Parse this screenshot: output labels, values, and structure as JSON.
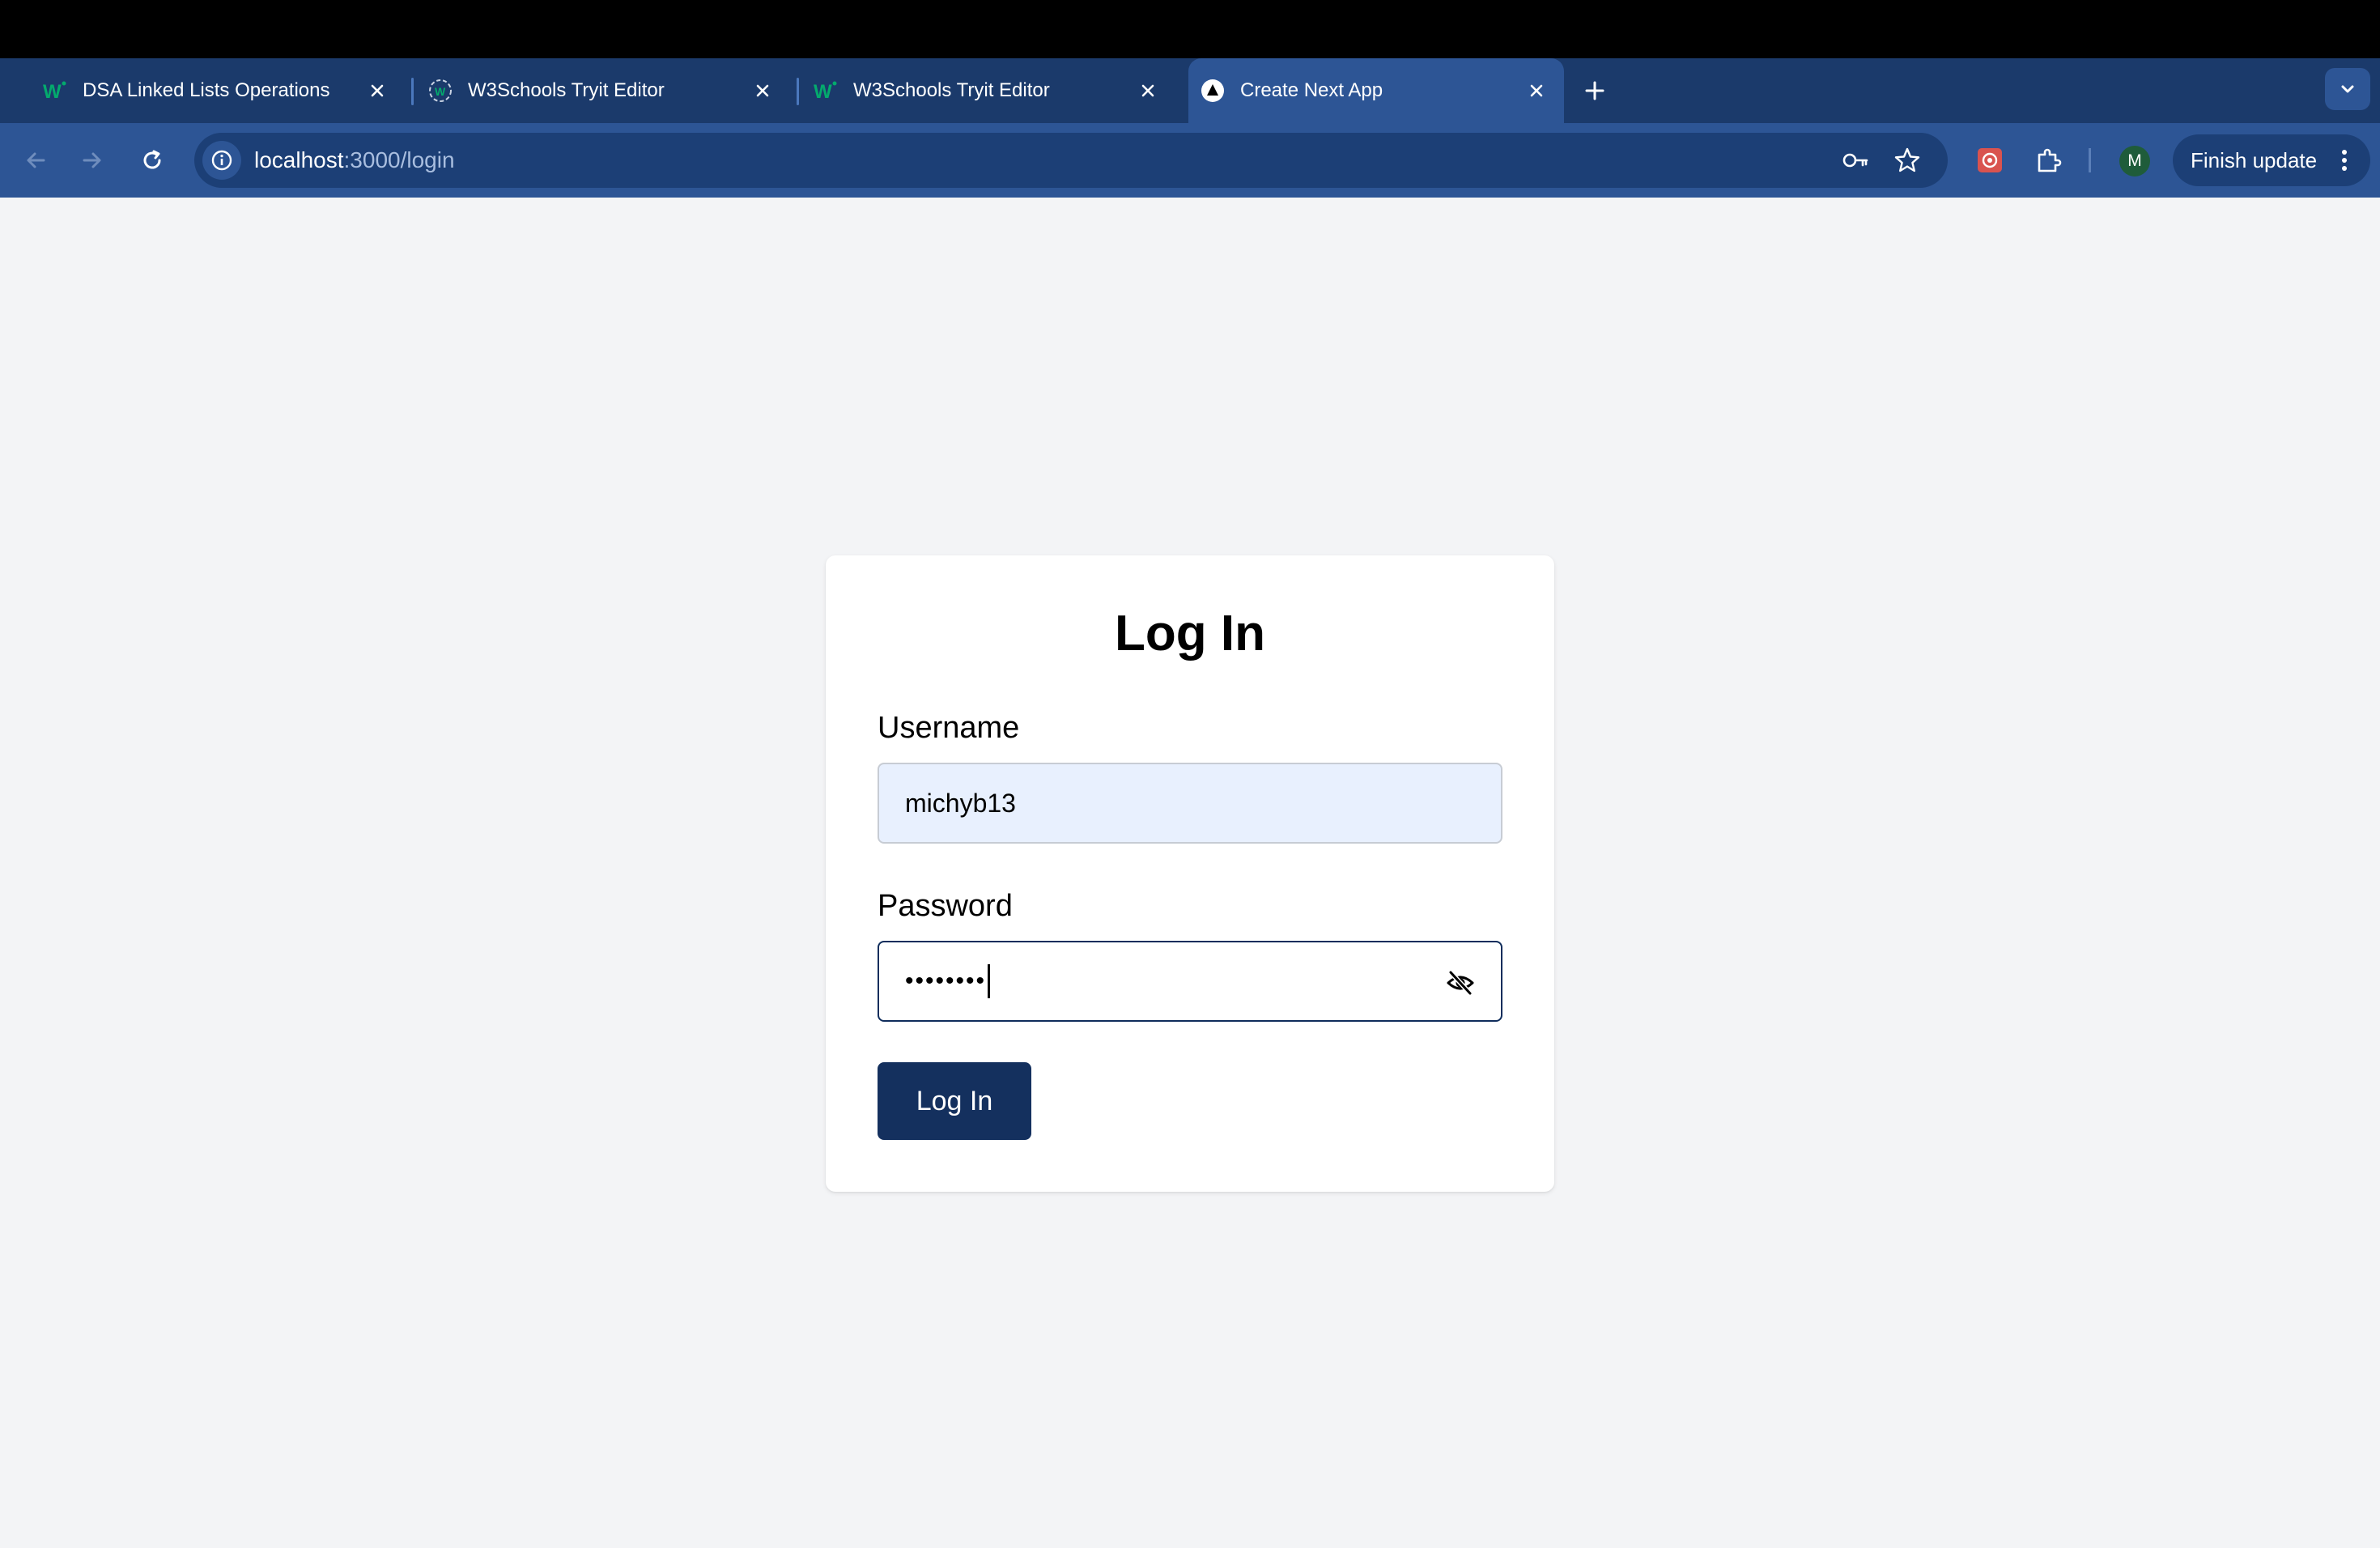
{
  "browser": {
    "tabs": [
      {
        "title": "DSA Linked Lists Operations",
        "icon": "w3schools-favicon",
        "active": false
      },
      {
        "title": "W3Schools Tryit Editor",
        "icon": "w3schools-tryit-favicon",
        "active": false
      },
      {
        "title": "W3Schools Tryit Editor",
        "icon": "w3schools-favicon",
        "active": false
      },
      {
        "title": "Create Next App",
        "icon": "nextjs-favicon",
        "active": true
      }
    ],
    "url": {
      "host": "localhost",
      "path": ":3000/login"
    },
    "profile_initial": "M",
    "finish_update_label": "Finish update"
  },
  "login": {
    "title": "Log In",
    "username_label": "Username",
    "username_value": "michyb13",
    "password_label": "Password",
    "password_masked": "••••••••",
    "submit_label": "Log In"
  },
  "colors": {
    "page_background": "#f3f4f6",
    "tabstrip": "#1b3a6b",
    "toolbar": "#2d5595",
    "button_primary": "#14305e",
    "autofill_background": "#e8f0fe"
  }
}
